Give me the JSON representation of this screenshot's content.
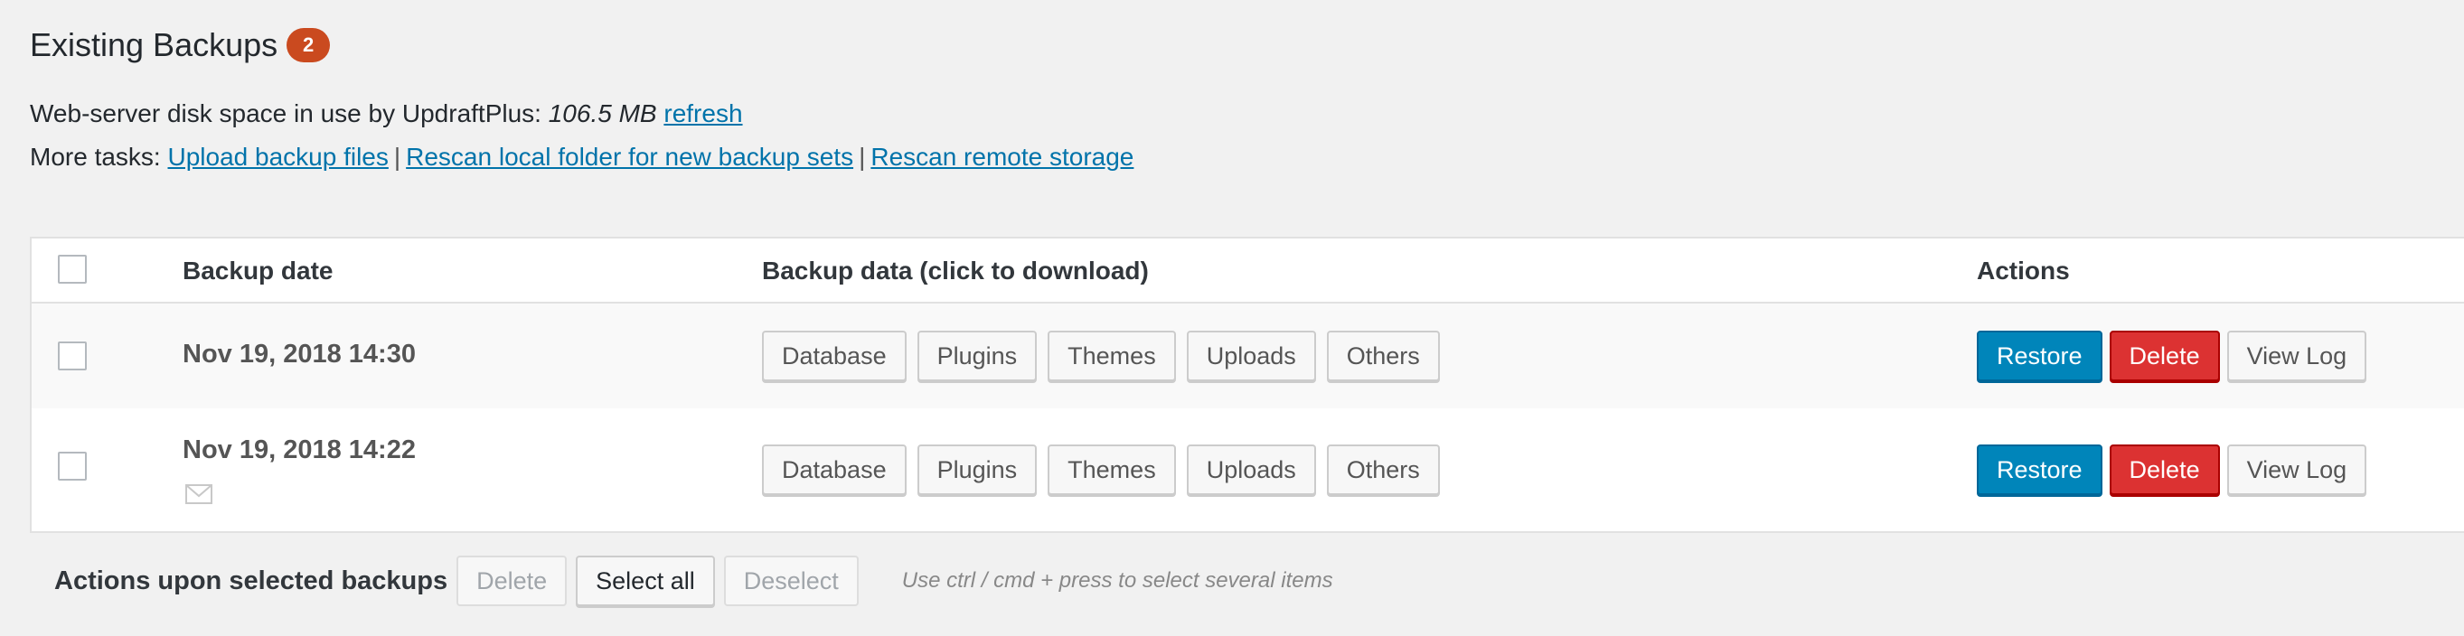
{
  "heading": {
    "title": "Existing Backups",
    "count": "2"
  },
  "disk": {
    "label": "Web-server disk space in use by UpdraftPlus:",
    "value": "106.5 MB",
    "refresh": "refresh"
  },
  "tasks": {
    "label": "More tasks:",
    "upload": "Upload backup files",
    "rescan_local": "Rescan local folder for new backup sets",
    "rescan_remote": "Rescan remote storage",
    "separator": "|"
  },
  "table": {
    "columns": {
      "date": "Backup date",
      "data": "Backup data (click to download)",
      "actions": "Actions"
    },
    "rows": [
      {
        "date": "Nov 19, 2018 14:30",
        "data": [
          "Database",
          "Plugins",
          "Themes",
          "Uploads",
          "Others"
        ],
        "restore": "Restore",
        "delete": "Delete",
        "view_log": "View Log"
      },
      {
        "date": "Nov 19, 2018 14:22",
        "data": [
          "Database",
          "Plugins",
          "Themes",
          "Uploads",
          "Others"
        ],
        "restore": "Restore",
        "delete": "Delete",
        "view_log": "View Log"
      }
    ]
  },
  "bulk": {
    "label": "Actions upon selected backups",
    "delete": "Delete",
    "select_all": "Select all",
    "deselect": "Deselect",
    "hint": "Use ctrl / cmd + press to select several items"
  },
  "colors": {
    "primary": "#0085ba",
    "danger": "#dc3232",
    "badge": "#ca4a1f",
    "link": "#0073aa"
  }
}
